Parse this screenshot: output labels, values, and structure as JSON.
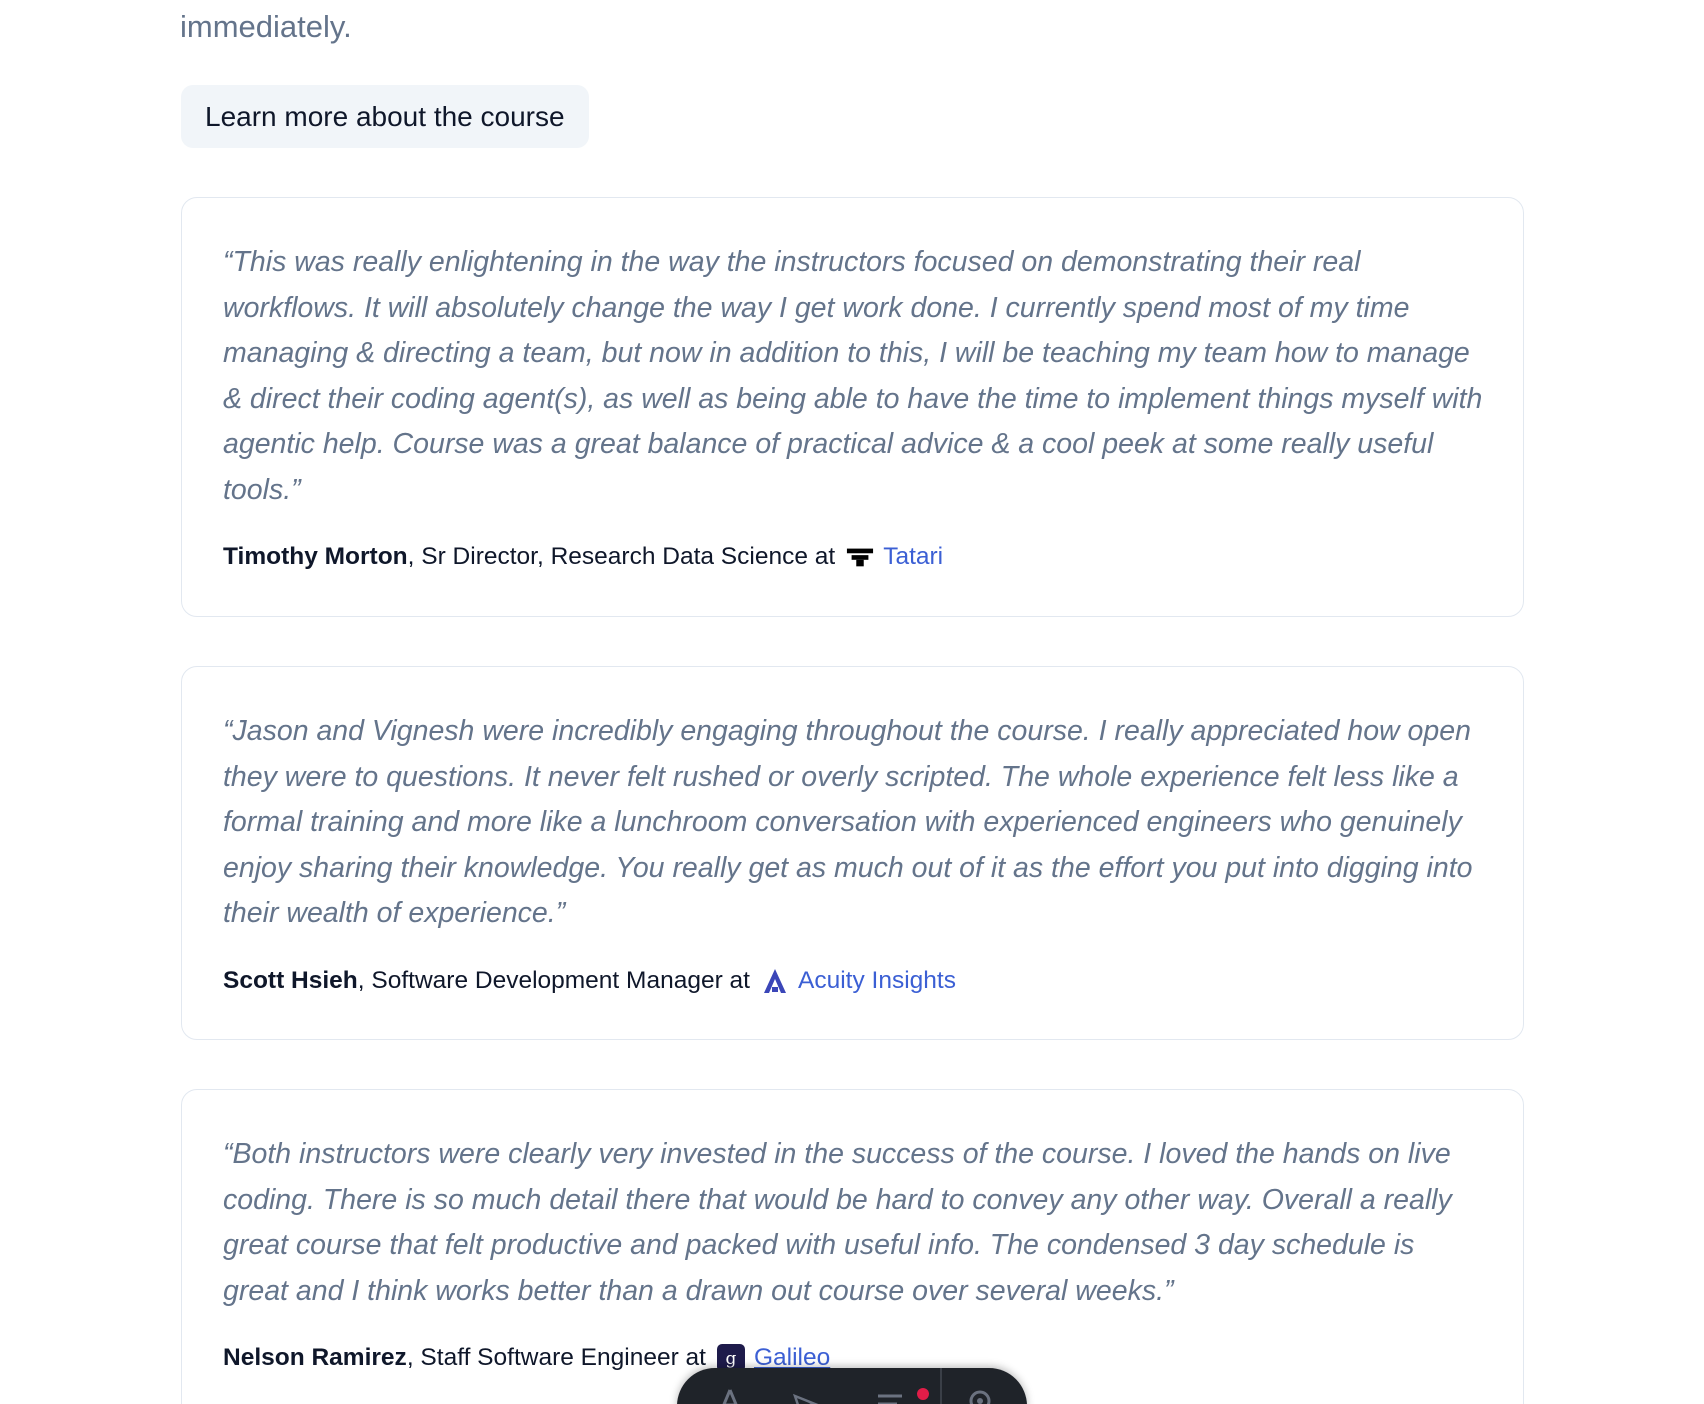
{
  "intro": {
    "tail_text": "immediately."
  },
  "cta": {
    "label": "Learn more about the course"
  },
  "testimonials": [
    {
      "quote": "“This was really enlightening in the way the instructors focused on demonstrating their real workflows. It will absolutely change the way I get work done. I currently spend most of my time managing & directing a team, but now in addition to this, I will be teaching my team how to manage & direct their coding agent(s), as well as being able to have the time to implement things myself with agentic help. Course was a great balance of practical advice & a cool peek at some really useful tools.”",
      "name": "Timothy Morton",
      "role": ", Sr Director, Research Data Science at",
      "company": "Tatari",
      "logo_icon": "tatari-logo-icon"
    },
    {
      "quote": "“Jason and Vignesh were incredibly engaging throughout the course. I really appreciated how open they were to questions. It never felt rushed or overly scripted. The whole experience felt less like a formal training and more like a lunchroom conversation with experienced engineers who genuinely enjoy sharing their knowledge. You really get as much out of it as the effort you put into digging into their wealth of experience.”",
      "name": "Scott Hsieh",
      "role": ", Software Development Manager at",
      "company": "Acuity Insights",
      "logo_icon": "acuity-logo-icon"
    },
    {
      "quote": "“Both instructors were clearly very invested in the success of the course. I loved the hands on live coding. There is so much detail there that would be hard to convey any other way. Overall a really great course that felt productive and packed with useful info. The condensed 3 day schedule is great and I think works better than a drawn out course over several weeks.”",
      "name": "Nelson Ramirez",
      "role": ", Staff Software Engineer at",
      "company": "Galileo",
      "logo_icon": "galileo-logo-icon"
    }
  ],
  "colors": {
    "text_primary": "#0f172a",
    "text_muted": "#64748b",
    "link": "#3b5fd4",
    "card_border": "#e2e8f0",
    "cta_bg": "#f1f5f9",
    "toolbar_bg": "#1f2329"
  },
  "floating_toolbar": {
    "icons": [
      "text-tool-icon",
      "pointer-tool-icon",
      "layers-icon",
      "settings-icon"
    ]
  }
}
